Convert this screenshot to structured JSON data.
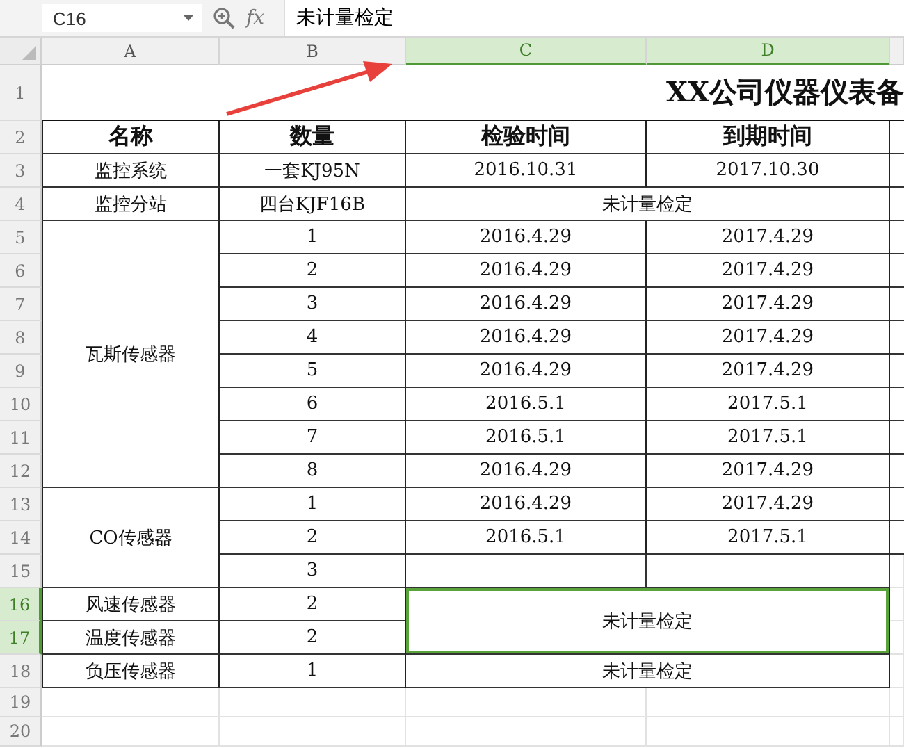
{
  "formula_bar": {
    "name_box": "C16",
    "fx": "fx",
    "formula": "未计量检定"
  },
  "columns": [
    {
      "label": "A",
      "selected": false
    },
    {
      "label": "B",
      "selected": false
    },
    {
      "label": "C",
      "selected": true
    },
    {
      "label": "D",
      "selected": true
    }
  ],
  "row_numbers": [
    {
      "label": "1",
      "selected": false
    },
    {
      "label": "2",
      "selected": false
    },
    {
      "label": "3",
      "selected": false
    },
    {
      "label": "4",
      "selected": false
    },
    {
      "label": "5",
      "selected": false
    },
    {
      "label": "6",
      "selected": false
    },
    {
      "label": "7",
      "selected": false
    },
    {
      "label": "8",
      "selected": false
    },
    {
      "label": "9",
      "selected": false
    },
    {
      "label": "10",
      "selected": false
    },
    {
      "label": "11",
      "selected": false
    },
    {
      "label": "12",
      "selected": false
    },
    {
      "label": "13",
      "selected": false
    },
    {
      "label": "14",
      "selected": false
    },
    {
      "label": "15",
      "selected": false
    },
    {
      "label": "16",
      "selected": true
    },
    {
      "label": "17",
      "selected": true
    },
    {
      "label": "18",
      "selected": false
    },
    {
      "label": "19",
      "selected": false
    },
    {
      "label": "20",
      "selected": false
    }
  ],
  "cells": [
    {
      "kind": "title",
      "text": "XX公司仪器仪表备",
      "selected": false
    },
    {
      "kind": "header",
      "text": "名称",
      "selected": false
    },
    {
      "kind": "header",
      "text": "数量",
      "selected": false
    },
    {
      "kind": "header",
      "text": "检验时间",
      "selected": false
    },
    {
      "kind": "header",
      "text": "到期时间",
      "selected": false
    },
    {
      "kind": "data",
      "text": "监控系统",
      "selected": false
    },
    {
      "kind": "data",
      "text": "一套KJ95N",
      "selected": false
    },
    {
      "kind": "data",
      "text": "2016.10.31",
      "selected": false
    },
    {
      "kind": "data",
      "text": "2017.10.30",
      "selected": false
    },
    {
      "kind": "data",
      "text": "监控分站",
      "selected": false
    },
    {
      "kind": "data",
      "text": "四台KJF16B",
      "selected": false
    },
    {
      "kind": "data",
      "text": "未计量检定",
      "selected": false
    },
    {
      "kind": "data",
      "text": "瓦斯传感器",
      "selected": false
    },
    {
      "kind": "data",
      "text": "1",
      "selected": false
    },
    {
      "kind": "data",
      "text": "2016.4.29",
      "selected": false
    },
    {
      "kind": "data",
      "text": "2017.4.29",
      "selected": false
    },
    {
      "kind": "data",
      "text": "2",
      "selected": false
    },
    {
      "kind": "data",
      "text": "2016.4.29",
      "selected": false
    },
    {
      "kind": "data",
      "text": "2017.4.29",
      "selected": false
    },
    {
      "kind": "data",
      "text": "3",
      "selected": false
    },
    {
      "kind": "data",
      "text": "2016.4.29",
      "selected": false
    },
    {
      "kind": "data",
      "text": "2017.4.29",
      "selected": false
    },
    {
      "kind": "data",
      "text": "4",
      "selected": false
    },
    {
      "kind": "data",
      "text": "2016.4.29",
      "selected": false
    },
    {
      "kind": "data",
      "text": "2017.4.29",
      "selected": false
    },
    {
      "kind": "data",
      "text": "5",
      "selected": false
    },
    {
      "kind": "data",
      "text": "2016.4.29",
      "selected": false
    },
    {
      "kind": "data",
      "text": "2017.4.29",
      "selected": false
    },
    {
      "kind": "data",
      "text": "6",
      "selected": false
    },
    {
      "kind": "data",
      "text": "2016.5.1",
      "selected": false
    },
    {
      "kind": "data",
      "text": "2017.5.1",
      "selected": false
    },
    {
      "kind": "data",
      "text": "7",
      "selected": false
    },
    {
      "kind": "data",
      "text": "2016.5.1",
      "selected": false
    },
    {
      "kind": "data",
      "text": "2017.5.1",
      "selected": false
    },
    {
      "kind": "data",
      "text": "8",
      "selected": false
    },
    {
      "kind": "data",
      "text": "2016.4.29",
      "selected": false
    },
    {
      "kind": "data",
      "text": "2017.4.29",
      "selected": false
    },
    {
      "kind": "data",
      "text": "CO传感器",
      "selected": false
    },
    {
      "kind": "data",
      "text": "1",
      "selected": false
    },
    {
      "kind": "data",
      "text": "2016.4.29",
      "selected": false
    },
    {
      "kind": "data",
      "text": "2017.4.29",
      "selected": false
    },
    {
      "kind": "data",
      "text": "2",
      "selected": false
    },
    {
      "kind": "data",
      "text": "2016.5.1",
      "selected": false
    },
    {
      "kind": "data",
      "text": "2017.5.1",
      "selected": false
    },
    {
      "kind": "data",
      "text": "3",
      "selected": false
    },
    {
      "kind": "data",
      "text": "风速传感器",
      "selected": false
    },
    {
      "kind": "data",
      "text": "2",
      "selected": false
    },
    {
      "kind": "data",
      "text": "未计量检定",
      "selected": true
    },
    {
      "kind": "data",
      "text": "温度传感器",
      "selected": false
    },
    {
      "kind": "data",
      "text": "2",
      "selected": false
    },
    {
      "kind": "data",
      "text": "负压传感器",
      "selected": false
    },
    {
      "kind": "data",
      "text": "1",
      "selected": false
    },
    {
      "kind": "data",
      "text": "未计量检定",
      "selected": false
    }
  ]
}
